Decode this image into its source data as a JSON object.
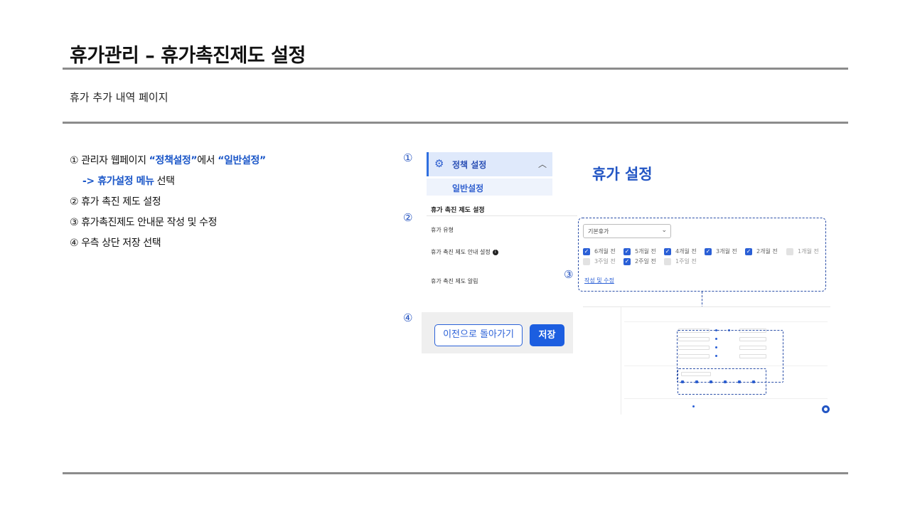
{
  "header": {
    "title": "휴가관리 – 휴가촉진제도 설정",
    "subtitle": "휴가 추가 내역 페이지"
  },
  "steps": {
    "s1_prefix": "① 관리자 웹페이지 ",
    "s1_policy": "“정책설정”",
    "s1_mid": "에서 ",
    "s1_general": "“일반설정”",
    "s1b_menu": "-> 휴가설정 메뉴",
    "s1b_suffix": " 선택",
    "s2": "② 휴가 촉진 제도 설정",
    "s3": "③ 휴가촉진제도 안내문 작성 및 수정",
    "s4": "④ 우측 상단 저장 선택"
  },
  "markers": {
    "m1": "①",
    "m2": "②",
    "m3": "③",
    "m4": "④"
  },
  "menu": {
    "gear_icon": "gear-icon",
    "policy_label": "정책 설정",
    "general_label": "일반설정"
  },
  "panel": {
    "title": "휴가 설정",
    "section_title": "휴가 촉진 제도 설정",
    "leave_type_label": "휴가 유형",
    "guide_label": "휴가 촉진 제도 안내 설정",
    "notice_label": "휴가 촉진 제도 알림",
    "select_value": "기본휴가",
    "link_label": "작성 및 수정"
  },
  "checkboxes": [
    {
      "label": "6개월 전",
      "checked": true
    },
    {
      "label": "5개월 전",
      "checked": true
    },
    {
      "label": "4개월 전",
      "checked": true
    },
    {
      "label": "3개월 전",
      "checked": true
    },
    {
      "label": "2개월 전",
      "checked": true
    },
    {
      "label": "1개월 전",
      "checked": false
    },
    {
      "label": "3주일 전",
      "checked": false
    },
    {
      "label": "2주일 전",
      "checked": true
    },
    {
      "label": "1주일 전",
      "checked": false
    }
  ],
  "buttons": {
    "prev_label": "이전으로 돌아가기",
    "save_label": "저장"
  },
  "colors": {
    "accent": "#1c5ee0",
    "highlight_text": "#1a56c8",
    "rule": "#8c8c8c"
  }
}
